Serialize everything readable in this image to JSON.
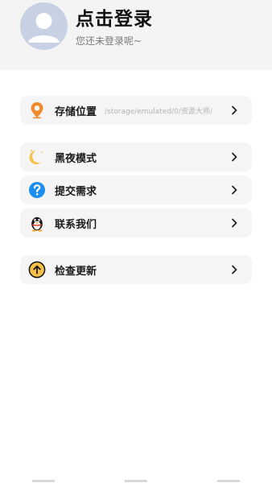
{
  "user": {
    "title": "点击登录",
    "subtitle": "您还未登录呢~"
  },
  "menu": {
    "storage": {
      "label": "存储位置",
      "value": "/storage/emulated/0/资源大师/"
    },
    "dark_mode": {
      "label": "黑夜模式"
    },
    "submit_request": {
      "label": "提交需求"
    },
    "contact_us": {
      "label": "联系我们"
    },
    "check_update": {
      "label": "检查更新"
    }
  },
  "colors": {
    "header_bg": "#f4f4f4",
    "card_bg": "#f5f5f5",
    "location_icon": "#f08a2b",
    "moon_icon": "#f6c146",
    "help_icon": "#1d8ef0",
    "update_icon": "#f6c146"
  },
  "icons": [
    "avatar-icon",
    "location-pin-icon",
    "moon-icon",
    "help-icon",
    "qq-penguin-icon",
    "upload-arrow-icon",
    "chevron-right-icon"
  ]
}
